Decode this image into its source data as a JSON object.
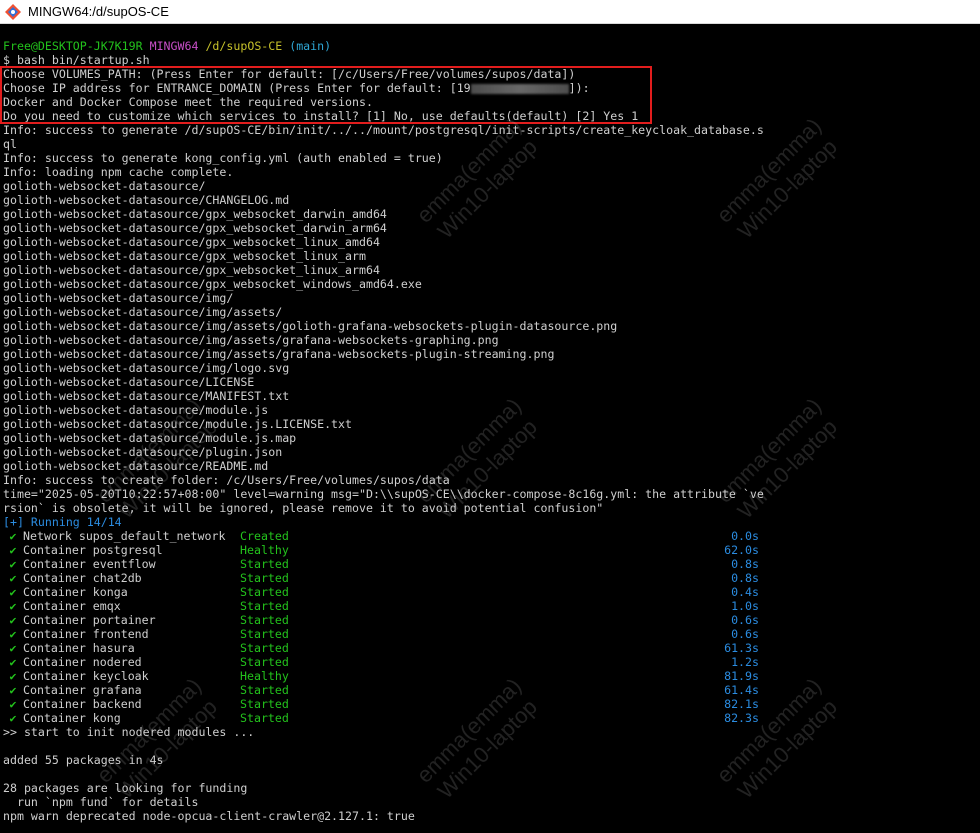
{
  "window": {
    "title": "MINGW64:/d/supOS-CE",
    "icon": "git-bash-icon"
  },
  "prompt": {
    "user": "Free@DESKTOP-JK7K19R",
    "shell": "MINGW64",
    "path": "/d/supOS-CE",
    "branch": "(main)"
  },
  "command": "$ bash bin/startup.sh",
  "prompts_block": {
    "volumes": "Choose VOLUMES_PATH: (Press Enter for default: [/c/Users/Free/volumes/supos/data])",
    "ip_prefix": "Choose IP address for ENTRANCE_DOMAIN (Press Enter for default: [19",
    "ip_suffix": "]):",
    "docker": "Docker and Docker Compose meet the required versions.",
    "customize": "Do you need to customize which services to install? [1] No, use defaults(default) [2] Yes 1"
  },
  "log_lines": [
    "Info: success to generate /d/supOS-CE/bin/init/../../mount/postgresql/init-scripts/create_keycloak_database.s",
    "ql",
    "Info: success to generate kong_config.yml (auth enabled = true)",
    "Info: loading npm cache complete.",
    "golioth-websocket-datasource/",
    "golioth-websocket-datasource/CHANGELOG.md",
    "golioth-websocket-datasource/gpx_websocket_darwin_amd64",
    "golioth-websocket-datasource/gpx_websocket_darwin_arm64",
    "golioth-websocket-datasource/gpx_websocket_linux_amd64",
    "golioth-websocket-datasource/gpx_websocket_linux_arm",
    "golioth-websocket-datasource/gpx_websocket_linux_arm64",
    "golioth-websocket-datasource/gpx_websocket_windows_amd64.exe",
    "golioth-websocket-datasource/img/",
    "golioth-websocket-datasource/img/assets/",
    "golioth-websocket-datasource/img/assets/golioth-grafana-websockets-plugin-datasource.png",
    "golioth-websocket-datasource/img/assets/grafana-websockets-graphing.png",
    "golioth-websocket-datasource/img/assets/grafana-websockets-plugin-streaming.png",
    "golioth-websocket-datasource/img/logo.svg",
    "golioth-websocket-datasource/LICENSE",
    "golioth-websocket-datasource/MANIFEST.txt",
    "golioth-websocket-datasource/module.js",
    "golioth-websocket-datasource/module.js.LICENSE.txt",
    "golioth-websocket-datasource/module.js.map",
    "golioth-websocket-datasource/plugin.json",
    "golioth-websocket-datasource/README.md",
    "Info: success to create folder: /c/Users/Free/volumes/supos/data",
    "time=\"2025-05-20T10:22:57+08:00\" level=warning msg=\"D:\\\\supOS-CE\\\\docker-compose-8c16g.yml: the attribute `ve",
    "rsion` is obsolete, it will be ignored, please remove it to avoid potential confusion\""
  ],
  "running_header": "[+] Running 14/14",
  "check_glyph": "✔",
  "services": [
    {
      "name": "Network supos_default_network",
      "status": "Created",
      "time": "0.0s"
    },
    {
      "name": "Container postgresql",
      "status": "Healthy",
      "time": "62.0s"
    },
    {
      "name": "Container eventflow",
      "status": "Started",
      "time": "0.8s"
    },
    {
      "name": "Container chat2db",
      "status": "Started",
      "time": "0.8s"
    },
    {
      "name": "Container konga",
      "status": "Started",
      "time": "0.4s"
    },
    {
      "name": "Container emqx",
      "status": "Started",
      "time": "1.0s"
    },
    {
      "name": "Container portainer",
      "status": "Started",
      "time": "0.6s"
    },
    {
      "name": "Container frontend",
      "status": "Started",
      "time": "0.6s"
    },
    {
      "name": "Container hasura",
      "status": "Started",
      "time": "61.3s"
    },
    {
      "name": "Container nodered",
      "status": "Started",
      "time": "1.2s"
    },
    {
      "name": "Container keycloak",
      "status": "Healthy",
      "time": "81.9s"
    },
    {
      "name": "Container grafana",
      "status": "Started",
      "time": "61.4s"
    },
    {
      "name": "Container backend",
      "status": "Started",
      "time": "82.1s"
    },
    {
      "name": "Container kong",
      "status": "Started",
      "time": "82.3s"
    }
  ],
  "tail_lines": [
    ">> start to init nodered modules ...",
    "",
    "added 55 packages in 4s",
    "",
    "28 packages are looking for funding",
    "  run `npm fund` for details",
    "npm warn deprecated node-opcua-client-crawler@2.127.1: true"
  ],
  "watermark": {
    "line1": "emma(emma)",
    "line2": "Win10-laptop"
  },
  "colors": {
    "terminal_bg": "#000000",
    "text": "#cfcfcf",
    "green": "#23c21c",
    "magenta": "#c84fc8",
    "yellow": "#c6c12a",
    "cyan": "#2fa6d4",
    "blue": "#2b8ce0",
    "highlight_border": "#e21d1d"
  }
}
